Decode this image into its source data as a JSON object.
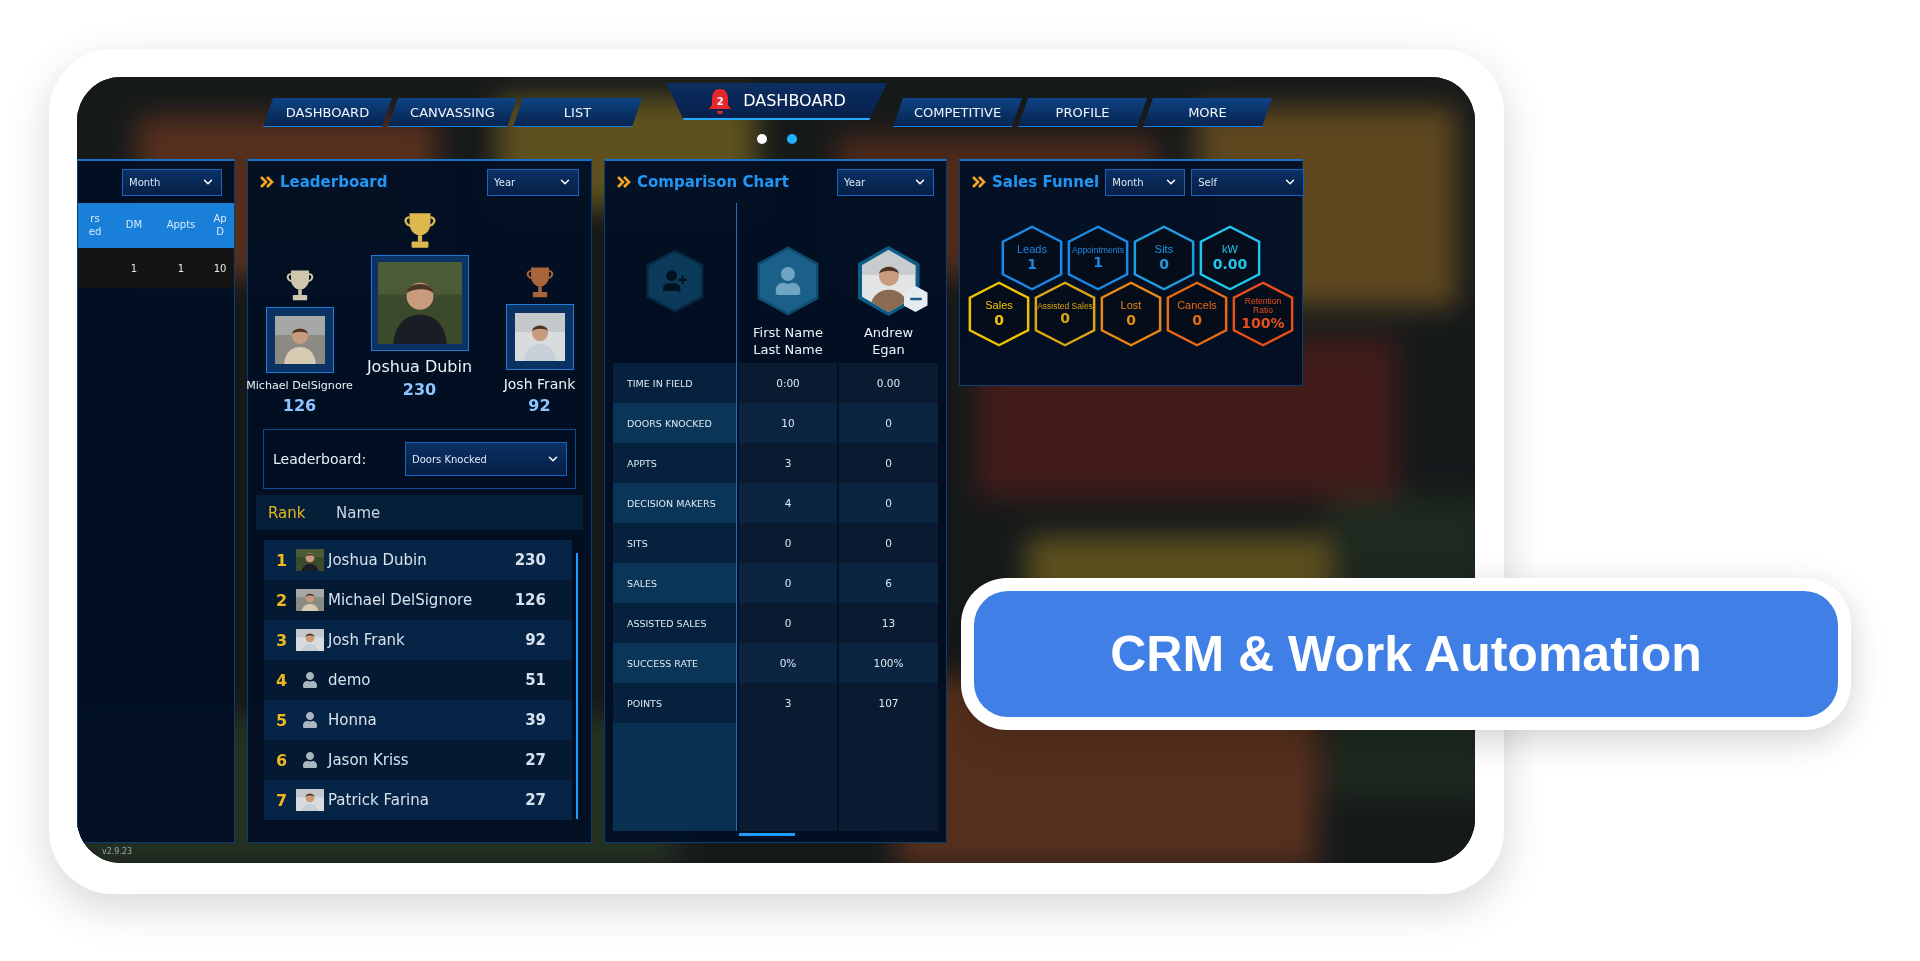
{
  "nav": {
    "tabs_left": [
      "DASHBOARD",
      "CANVASSING",
      "LIST"
    ],
    "title": "DASHBOARD",
    "notifications": "2",
    "tabs_right": [
      "COMPETITIVE",
      "PROFILE",
      "MORE"
    ],
    "pages": [
      {
        "selected": false
      },
      {
        "selected": true
      }
    ]
  },
  "stats_panel": {
    "period": "Month",
    "columns": [
      {
        "lines": [
          "rs",
          "ed"
        ]
      },
      {
        "lines": [
          "DM"
        ]
      },
      {
        "lines": [
          "Appts"
        ]
      },
      {
        "lines": [
          "Ap",
          "D"
        ]
      }
    ],
    "rows": [
      {
        "values": [
          "1",
          "1",
          "10"
        ]
      }
    ],
    "version": "v2.9.23"
  },
  "leaderboard": {
    "title": "Leaderboard",
    "period": "Year",
    "podium": [
      {
        "kind": "runner",
        "name": "Michael DelSignore",
        "score": "126",
        "color": "#cfc6ae"
      },
      {
        "kind": "first",
        "name": "Joshua Dubin",
        "score": "230",
        "color": "#dcb84e"
      },
      {
        "kind": "runner",
        "name": "Josh Frank",
        "score": "92",
        "color": "#a9653a"
      }
    ],
    "metric_label": "Leaderboard:",
    "metric": "Doors Knocked",
    "columns": [
      "Rank",
      "Name"
    ],
    "rows": [
      {
        "rank": "1",
        "name": "Joshua Dubin",
        "score": "230"
      },
      {
        "rank": "2",
        "name": "Michael DelSignore",
        "score": "126"
      },
      {
        "rank": "3",
        "name": "Josh Frank",
        "score": "92"
      },
      {
        "rank": "4",
        "kind": "default",
        "name": "demo",
        "score": "51"
      },
      {
        "rank": "5",
        "kind": "default",
        "name": "Honna",
        "score": "39"
      },
      {
        "rank": "6",
        "kind": "default",
        "name": "Jason Kriss",
        "score": "27"
      },
      {
        "rank": "7",
        "name": "Patrick Farina",
        "score": "27"
      }
    ]
  },
  "comparison": {
    "title": "Comparison Chart",
    "period": "Year",
    "people": [
      {
        "kind": "default",
        "name": "First Name\nLast Name",
        "removable": false
      },
      {
        "name": "Andrew\nEgan",
        "removable": true
      }
    ],
    "rows": [
      {
        "label": "TIME IN FIELD",
        "values": [
          "0:00",
          "0.00"
        ]
      },
      {
        "label": "DOORS KNOCKED",
        "values": [
          "10",
          "0"
        ]
      },
      {
        "label": "APPTS",
        "values": [
          "3",
          "0"
        ]
      },
      {
        "label": "DECISION MAKERS",
        "values": [
          "4",
          "0"
        ]
      },
      {
        "label": "SITS",
        "values": [
          "0",
          "0"
        ]
      },
      {
        "label": "SALES",
        "values": [
          "0",
          "6"
        ]
      },
      {
        "label": "ASSISTED SALES",
        "values": [
          "0",
          "13"
        ]
      },
      {
        "label": "SUCCESS RATE",
        "values": [
          "0%",
          "100%"
        ]
      },
      {
        "label": "POINTS",
        "values": [
          "3",
          "107"
        ]
      }
    ]
  },
  "sales_funnel": {
    "title": "Sales Funnel",
    "period": "Month",
    "scope": "Self",
    "rows": [
      [
        {
          "label": "Leads",
          "value": "1",
          "color": "#1e88e5"
        },
        {
          "label": "Appointments",
          "value": "1",
          "color": "#1e88e5"
        },
        {
          "label": "Sits",
          "value": "0",
          "color": "#1e9fe0"
        },
        {
          "label": "kW",
          "value": "0.00",
          "color": "#22c4ec"
        }
      ],
      [
        {
          "label": "Sales",
          "value": "0",
          "color": "#f2c200"
        },
        {
          "label": "Assisted Sales",
          "value": "0",
          "color": "#dfa514"
        },
        {
          "label": "Lost",
          "value": "0",
          "color": "#e88a12"
        },
        {
          "label": "Cancels",
          "value": "0",
          "color": "#e86a12"
        },
        {
          "label": "Retention Ratio",
          "value": "100%",
          "color": "#e8501a"
        }
      ]
    ]
  },
  "badge": "CRM & Work Automation"
}
